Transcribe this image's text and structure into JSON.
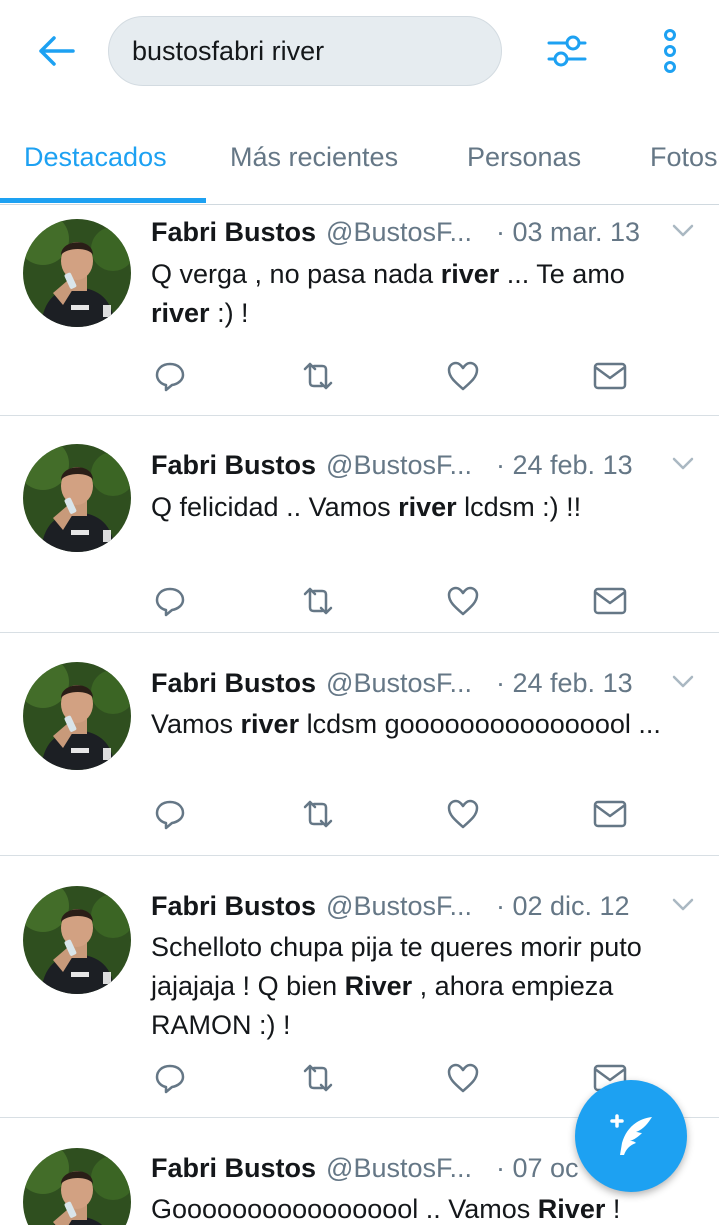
{
  "header": {
    "back_icon": "arrow-left-icon",
    "search_query": "bustosfabri river",
    "filter_icon": "sliders-icon",
    "more_icon": "vertical-dots-icon"
  },
  "tabs": [
    {
      "label": "Destacados",
      "active": true
    },
    {
      "label": "Más recientes",
      "active": false
    },
    {
      "label": "Personas",
      "active": false
    },
    {
      "label": "Fotos",
      "active": false
    }
  ],
  "tweets": [
    {
      "name": "Fabri Bustos",
      "handle": "@BustosF...",
      "date": "· 03 mar. 13",
      "segments": [
        {
          "t": "Q verga , no pasa nada ",
          "b": false
        },
        {
          "t": "river",
          "b": true
        },
        {
          "t": " ... Te amo ",
          "b": false
        },
        {
          "t": "river",
          "b": true
        },
        {
          "t": " :) !",
          "b": false
        }
      ]
    },
    {
      "name": "Fabri Bustos",
      "handle": "@BustosF...",
      "date": "· 24 feb. 13",
      "segments": [
        {
          "t": "Q felicidad .. Vamos ",
          "b": false
        },
        {
          "t": "river",
          "b": true
        },
        {
          "t": " lcdsm :) !!",
          "b": false
        }
      ]
    },
    {
      "name": "Fabri Bustos",
      "handle": "@BustosF...",
      "date": "· 24 feb. 13",
      "segments": [
        {
          "t": "Vamos ",
          "b": false
        },
        {
          "t": "river",
          "b": true
        },
        {
          "t": " lcdsm goooooooooooooool ...",
          "b": false
        }
      ]
    },
    {
      "name": "Fabri Bustos",
      "handle": "@BustosF...",
      "date": "· 02 dic. 12",
      "segments": [
        {
          "t": "Schelloto chupa pija te queres morir puto jajajaja ! Q bien ",
          "b": false
        },
        {
          "t": "River",
          "b": true
        },
        {
          "t": " , ahora empieza RAMON :) !",
          "b": false
        }
      ]
    },
    {
      "name": "Fabri Bustos",
      "handle": "@BustosF...",
      "date": "· 07 oc",
      "segments": [
        {
          "t": "Gooooooooooooooool .. Vamos ",
          "b": false
        },
        {
          "t": "River",
          "b": true
        },
        {
          "t": " !",
          "b": false
        }
      ]
    }
  ],
  "tweet_actions": [
    "reply-icon",
    "retweet-icon",
    "like-icon",
    "direct-message-icon"
  ],
  "compose_fab": {
    "icon": "compose-quill-icon"
  },
  "colors": {
    "accent": "#1da1f2",
    "secondary_text": "#657786",
    "divider": "#d8dfe4",
    "search_bg": "#e6ecf0"
  }
}
